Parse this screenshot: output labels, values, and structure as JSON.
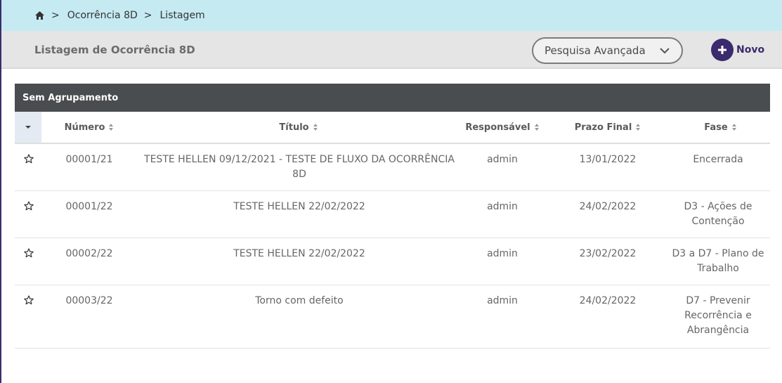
{
  "breadcrumb": {
    "items": [
      "Ocorrência 8D",
      "Listagem"
    ],
    "separator": ">"
  },
  "header": {
    "title": "Listagem de Ocorrência 8D",
    "search_label": "Pesquisa Avançada",
    "new_label": "Novo"
  },
  "table": {
    "group_label": "Sem Agrupamento",
    "columns": [
      "Número",
      "Título",
      "Responsável",
      "Prazo Final",
      "Fase"
    ],
    "rows": [
      {
        "numero": "00001/21",
        "titulo": "TESTE HELLEN 09/12/2021 - TESTE DE FLUXO DA OCORRÊNCIA 8D",
        "responsavel": "admin",
        "prazo": "13/01/2022",
        "fase": "Encerrada"
      },
      {
        "numero": "00001/22",
        "titulo": "TESTE HELLEN 22/02/2022",
        "responsavel": "admin",
        "prazo": "24/02/2022",
        "fase": "D3 - Ações de Contenção"
      },
      {
        "numero": "00002/22",
        "titulo": "TESTE HELLEN 22/02/2022",
        "responsavel": "admin",
        "prazo": "23/02/2022",
        "fase": "D3 a D7 - Plano de Trabalho"
      },
      {
        "numero": "00003/22",
        "titulo": "Torno com defeito",
        "responsavel": "admin",
        "prazo": "24/02/2022",
        "fase": "D7 - Prevenir Recorrência e Abrangência"
      }
    ]
  },
  "colors": {
    "breadcrumb_bg": "#c5eaf2",
    "accent": "#3b2a6d",
    "group_header_bg": "#4a4d4f"
  }
}
